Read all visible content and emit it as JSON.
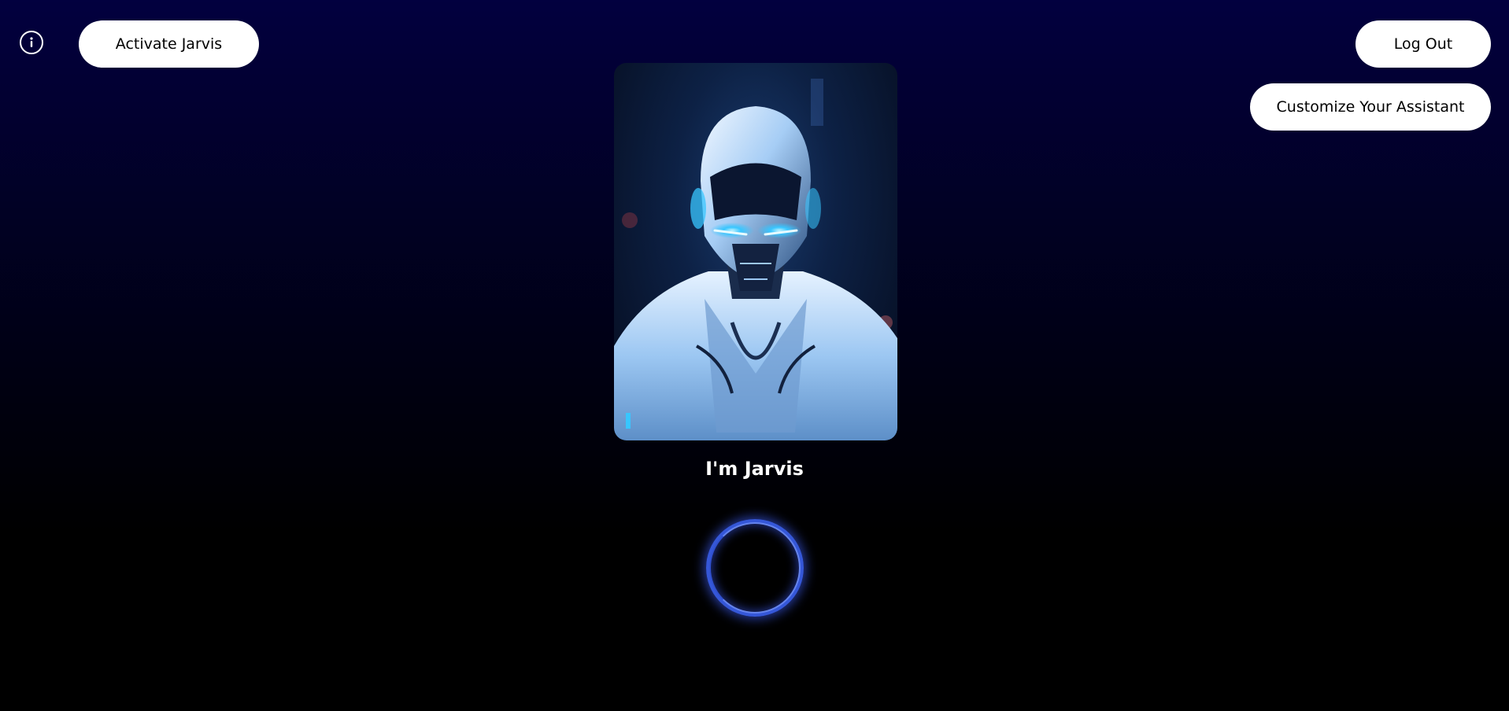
{
  "header": {
    "info_icon": "info-icon",
    "activate_label": "Activate Jarvis",
    "logout_label": "Log Out",
    "customize_label": "Customize Your Assistant"
  },
  "assistant": {
    "portrait_alt": "Jarvis",
    "name_heading": "I'm Jarvis"
  },
  "voice": {
    "icon": "voice-ring-icon"
  },
  "colors": {
    "background_top": "#02003f",
    "background_bottom": "#000000",
    "button_bg": "#ffffff",
    "button_text": "#000000",
    "ring_accent": "#3557d8",
    "visor_glow": "#38c6ff"
  }
}
